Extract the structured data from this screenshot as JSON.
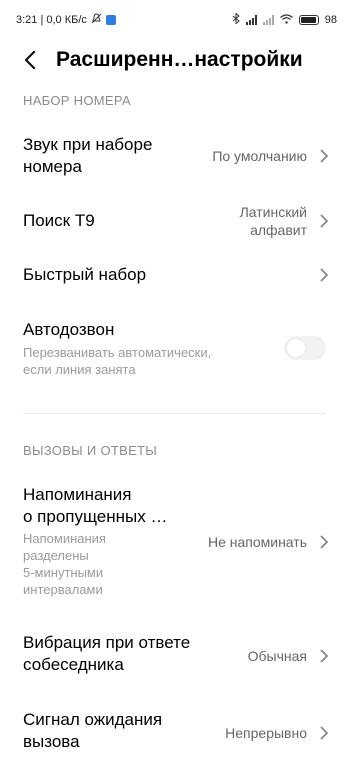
{
  "status_bar": {
    "time_speed": "3:21 | 0,0 КБ/с",
    "battery": "98"
  },
  "header": {
    "title": "Расширенн…настройки"
  },
  "sections": {
    "dialing": {
      "header": "НАБОР НОМЕРА",
      "dial_sound": {
        "title_line1": "Звук при наборе",
        "title_line2": "номера",
        "value": "По умолчанию"
      },
      "t9": {
        "title": "Поиск Т9",
        "value_line1": "Латинский",
        "value_line2": "алфавит"
      },
      "speed_dial": {
        "title": "Быстрый набор"
      },
      "auto_redial": {
        "title": "Автодозвон",
        "sub_line1": "Перезванивать автоматически,",
        "sub_line2": "если линия занята",
        "enabled": false
      }
    },
    "calls": {
      "header": "ВЫЗОВЫ И ОТВЕТЫ",
      "missed_reminder": {
        "title_line1": "Напоминания",
        "title_line2": "о пропущенных …",
        "sub_line1": "Напоминания",
        "sub_line2": "разделены",
        "sub_line3": "5-минутными",
        "sub_line4": "интервалами",
        "value": "Не напоминать"
      },
      "answer_vibration": {
        "title_line1": "Вибрация при ответе",
        "title_line2": "собеседника",
        "value": "Обычная"
      },
      "call_waiting": {
        "title_line1": "Сигнал ожидания",
        "title_line2": "вызова",
        "value": "Непрерывно"
      }
    }
  },
  "colors": {
    "accent": "#2f7de1",
    "section_header": "#8a8a92",
    "value_text": "#666666",
    "toggle_off": "#f1f1f3"
  }
}
